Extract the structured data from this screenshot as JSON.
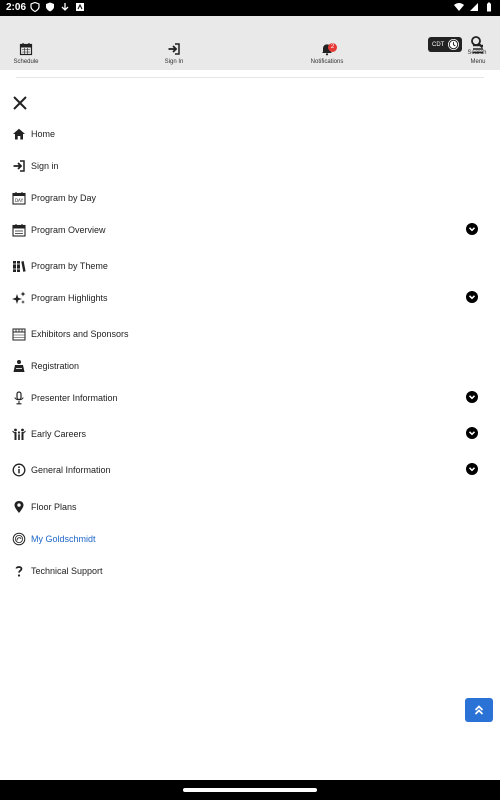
{
  "status_bar": {
    "time": "2:06"
  },
  "toolbar": {
    "schedule": "Schedule",
    "signin": "Sign In",
    "notifications": "Notifications",
    "notifications_badge": "2",
    "menu": "Menu",
    "timezone": "CDT",
    "search": "Search"
  },
  "menu": {
    "items": [
      {
        "label": "Home",
        "icon": "home-icon",
        "expandable": false
      },
      {
        "label": "Sign in",
        "icon": "sign-in-icon",
        "expandable": false
      },
      {
        "label": "Program by Day",
        "icon": "calendar-day-icon",
        "expandable": false
      },
      {
        "label": "Program Overview",
        "icon": "calendar-icon",
        "expandable": true
      },
      {
        "label": "Program by Theme",
        "icon": "books-icon",
        "expandable": false
      },
      {
        "label": "Program Highlights",
        "icon": "sparkles-icon",
        "expandable": true
      },
      {
        "label": "Exhibitors and Sponsors",
        "icon": "store-icon",
        "expandable": false
      },
      {
        "label": "Registration",
        "icon": "registration-icon",
        "expandable": false
      },
      {
        "label": "Presenter Information",
        "icon": "microphone-icon",
        "expandable": true
      },
      {
        "label": "Early Careers",
        "icon": "people-icon",
        "expandable": true
      },
      {
        "label": "General Information",
        "icon": "info-icon",
        "expandable": true
      },
      {
        "label": "Floor Plans",
        "icon": "map-pin-icon",
        "expandable": false
      },
      {
        "label": "My Goldschmidt",
        "icon": "goldschmidt-logo-icon",
        "expandable": false,
        "active": true
      },
      {
        "label": "Technical Support",
        "icon": "question-icon",
        "expandable": false
      }
    ]
  },
  "colors": {
    "accent": "#2a72d6",
    "active_link": "#1e66c8",
    "badge": "#e53935",
    "toolbar_bg": "#e9e9e9"
  }
}
